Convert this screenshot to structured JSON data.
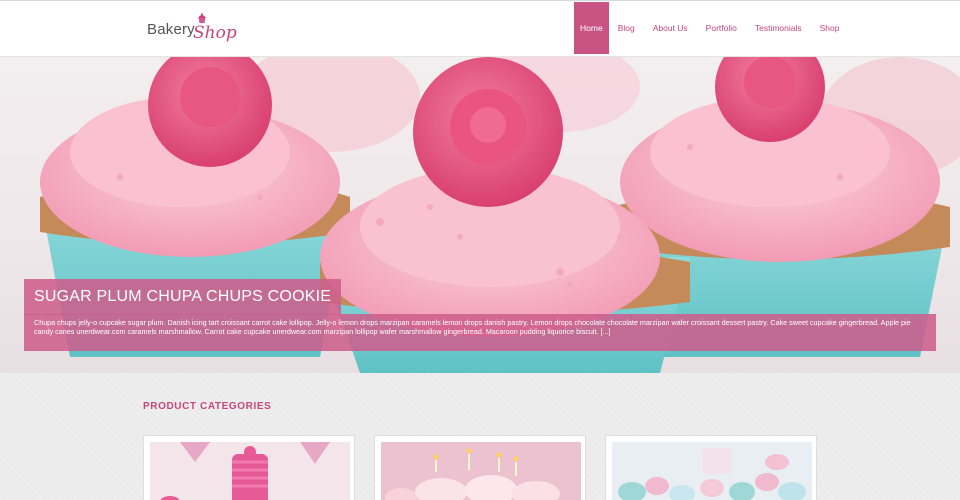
{
  "logo": {
    "text_main": "Bakery",
    "text_script": "Shop"
  },
  "nav": [
    {
      "label": "Home",
      "active": true
    },
    {
      "label": "Blog",
      "active": false
    },
    {
      "label": "About Us",
      "active": false
    },
    {
      "label": "Portfolio",
      "active": false
    },
    {
      "label": "Testimonials",
      "active": false
    },
    {
      "label": "Shop",
      "active": false
    }
  ],
  "slide": {
    "title": "SUGAR PLUM CHUPA CHUPS COOKIE",
    "text": "Chupa chups jelly-o cupcake sugar plum. Danish icing tart croissant carrot cake lollipop. Jelly-o lemon drops marzipan caramels lemon drops danish pastry. Lemon drops chocolate chocolate marzipan wafer croissant dessert pastry. Cake sweet cupcake gingerbread. Apple pie candy canes unerdwear.com caramels marshmallow. Carrot cake cupcake unerdwear.com marzipan lollipop wafer marshmallow gingerbread. Macaroon pudding liquorice biscuit. [...]"
  },
  "categories": {
    "title": "PRODUCT CATEGORIES"
  },
  "colors": {
    "accent": "#c95483",
    "caption_bg": "#cd5e8c",
    "frosting": "#f7b3c6",
    "rose": "#e2507f",
    "wrapper": "#7fd3d5"
  }
}
